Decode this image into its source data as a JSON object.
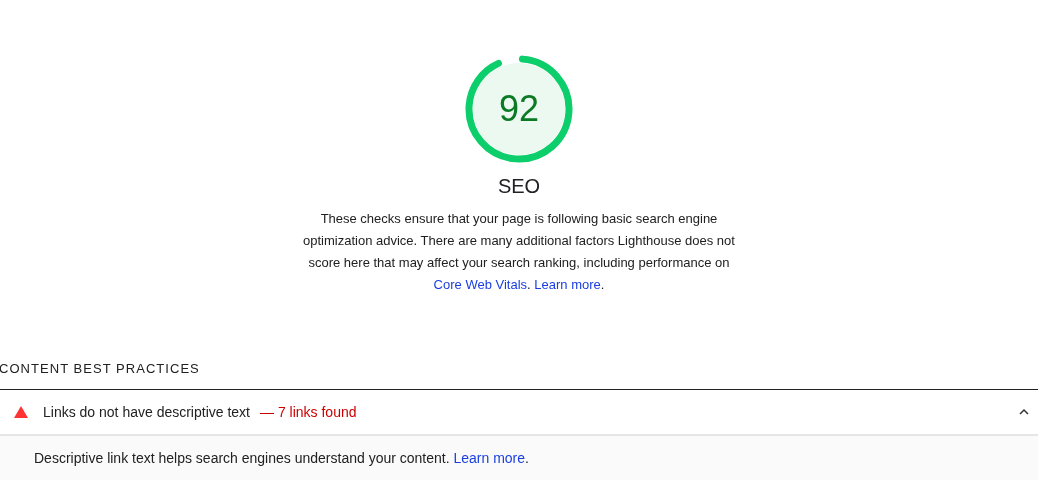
{
  "gauge": {
    "score": "92",
    "label": "SEO"
  },
  "description": [
    {
      "kind": "text",
      "text": "These checks ensure that your page is following basic search engine optimization advice. There are many additional factors Lighthouse does not score here that may affect your search ranking, including performance on "
    },
    {
      "kind": "link",
      "text": "Core Web Vitals"
    },
    {
      "kind": "text",
      "text": ". "
    },
    {
      "kind": "link",
      "text": "Learn more"
    },
    {
      "kind": "text",
      "text": "."
    }
  ],
  "group": {
    "title": "CONTENT BEST PRACTICES",
    "audits": [
      {
        "title": "Links do not have descriptive text",
        "display_value": "— 7 links found",
        "expanded": true,
        "description": [
          {
            "kind": "text",
            "text": "Descriptive link text helps search engines understand your content. "
          },
          {
            "kind": "link",
            "text": "Learn more"
          },
          {
            "kind": "text",
            "text": "."
          }
        ]
      }
    ]
  }
}
